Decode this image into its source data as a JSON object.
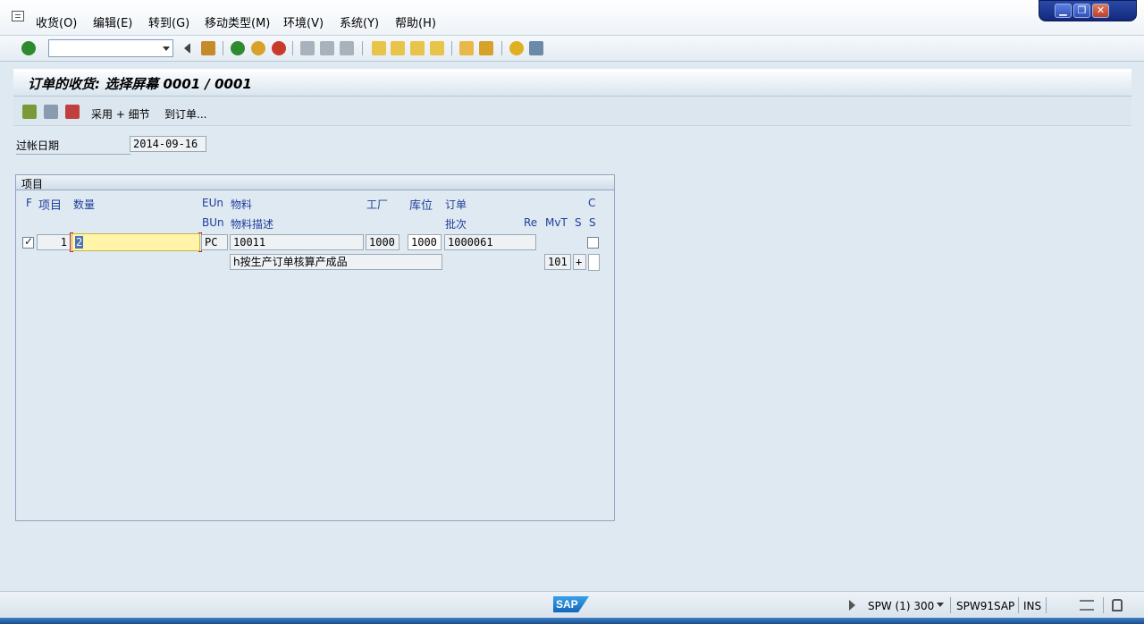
{
  "menu": {
    "items": [
      "收货(O)",
      "编辑(E)",
      "转到(G)",
      "移动类型(M)",
      "环境(V)",
      "系统(Y)",
      "帮助(H)"
    ]
  },
  "window": {
    "minimize": "▁",
    "restore": "❐",
    "close": "✕"
  },
  "toolbar": {
    "command_value": ""
  },
  "title": "订单的收货: 选择屏幕 0001 / 0001",
  "app_toolbar": {
    "adopt_details": "采用 + 细节",
    "to_order": "到订单..."
  },
  "header_fields": {
    "posting_date_label": "过帐日期",
    "posting_date": "2014-09-16"
  },
  "items_group": {
    "title": "项目",
    "columns_row1": {
      "f": "F",
      "item": "项目",
      "qty": "数量",
      "eun": "EUn",
      "material": "物料",
      "plant": "工厂",
      "sloc": "库位",
      "order": "订单",
      "c": "C"
    },
    "columns_row2": {
      "bun": "BUn",
      "material_desc": "物料描述",
      "batch": "批次",
      "re": "Re",
      "mvt": "MvT",
      "s": "S",
      "s2": "S"
    },
    "rows": [
      {
        "checked": true,
        "item_no": "1",
        "qty": "2",
        "unit": "PC",
        "material": "10011",
        "plant": "1000",
        "sloc": "1000",
        "order": "1000061",
        "description": "h按生产订单核算产成品",
        "mvt": "101",
        "s": "+"
      }
    ]
  },
  "status": {
    "system": "SPW (1) 300",
    "server": "SPW91SAP",
    "mode": "INS"
  },
  "colors": {
    "background": "#dfe9f2",
    "column_header": "#1f3f9a",
    "qty_highlight": "#fff4a8"
  }
}
